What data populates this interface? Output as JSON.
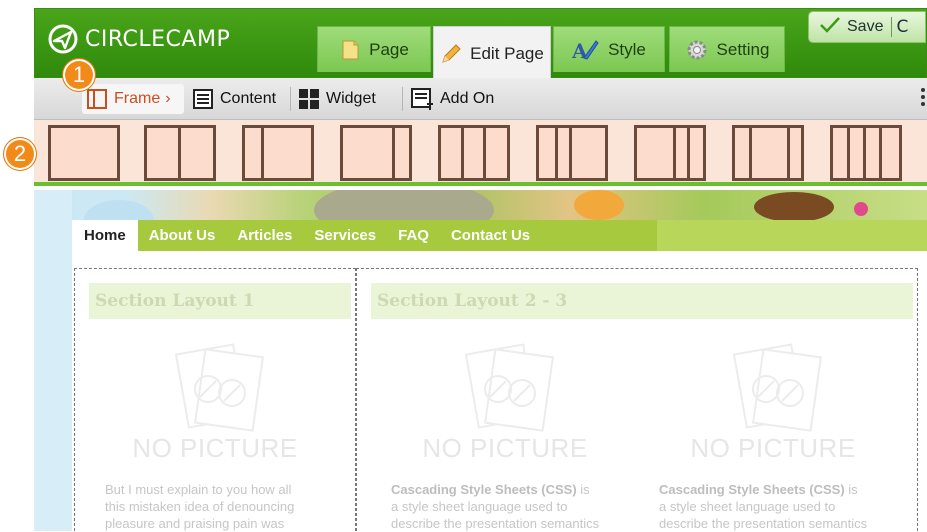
{
  "brand": {
    "name": "CIRCLECAMP"
  },
  "tabs": [
    {
      "label": "Page",
      "icon": "page-icon"
    },
    {
      "label": "Edit Page",
      "icon": "pencil-icon",
      "active": true
    },
    {
      "label": "Style",
      "icon": "paint-brush-icon"
    },
    {
      "label": "Setting",
      "icon": "gear-icon"
    }
  ],
  "save_button": {
    "label": "Save",
    "overflow_glyph": "C"
  },
  "toolbar": {
    "frame_label": "Frame",
    "frame_arrow": "›",
    "content_label": "Content",
    "widget_label": "Widget",
    "addon_label": "Add On"
  },
  "badges": {
    "one": "1",
    "two": "2"
  },
  "frame_layouts": [
    "1 column",
    "2 columns",
    "2 columns",
    "2 columns",
    "3 columns",
    "3 columns",
    "3 columns",
    "3 columns",
    "4 columns"
  ],
  "site_nav": [
    "Home",
    "About Us",
    "Articles",
    "Services",
    "FAQ",
    "Contact Us"
  ],
  "sections": [
    {
      "title": "Section Layout 1"
    },
    {
      "title": "Section Layout 2 - 3"
    }
  ],
  "no_picture": "NO PICTURE",
  "paragraphs": {
    "left": [
      "But I must explain to you how all",
      "this mistaken idea of denouncing",
      "pleasure and praising pain was"
    ],
    "css_bold": "Cascading Style Sheets (CSS)",
    "css_tail": " is",
    "css_lines": [
      "a style sheet language used to",
      "describe the presentation semantics"
    ]
  },
  "colors": {
    "header_green": "#3d9a14",
    "accent_orange": "#f28a1a",
    "nav_green": "#a6c93e",
    "layout_fill": "#fcdccc",
    "layout_stroke": "#6b4a3a"
  }
}
